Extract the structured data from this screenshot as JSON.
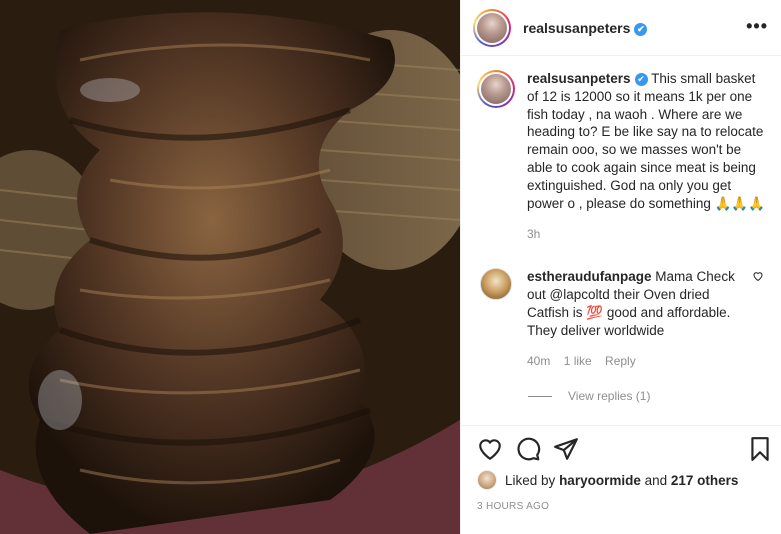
{
  "header": {
    "username": "realsusanpeters",
    "verified_symbol": "✔",
    "more_label": "•••"
  },
  "caption": {
    "username": "realsusanpeters",
    "text": "This small basket of 12 is 12000 so it means 1k per one fish today , na waoh . Where are we heading to? E be like say na to relocate remain ooo, so we masses won't be able to cook again since meat is being extinguished. God na only you get power o , please do something 🙏🙏🙏",
    "time": "3h"
  },
  "comment": {
    "username": "estheraudufanpage",
    "text": "Mama Check out @lapcoltd their Oven dried Catfish is 💯 good and affordable. They deliver worldwide",
    "time": "40m",
    "likes": "1 like",
    "reply_label": "Reply",
    "view_replies": "View replies (1)"
  },
  "likes": {
    "prefix": "Liked by",
    "user": "haryoormide",
    "connector": "and",
    "others": "217 others"
  },
  "post_time": "3 HOURS AGO",
  "icons": [
    "heart-icon",
    "comment-icon",
    "share-icon",
    "bookmark-icon",
    "more-icon",
    "verified-icon"
  ],
  "colors": {
    "verified": "#3897f0",
    "meta": "#8e8e8e",
    "border": "#efefef"
  }
}
